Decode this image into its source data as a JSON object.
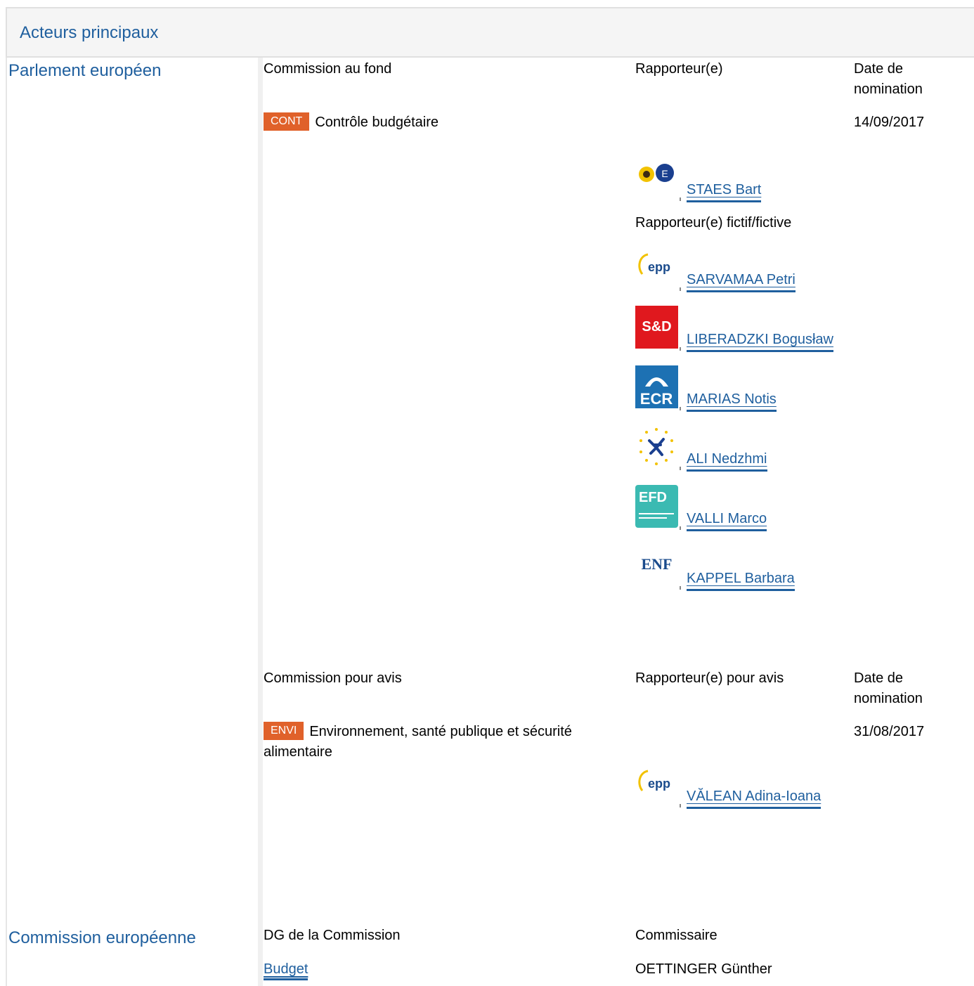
{
  "header": {
    "title": "Acteurs principaux"
  },
  "parliament": {
    "title": "Parlement européen",
    "lead": {
      "col_committee": "Commission au fond",
      "col_rapporteur": "Rapporteur(e)",
      "col_date": "Date de nomination",
      "committee_code": "CONT",
      "committee_name": "Contrôle budgétaire",
      "date": "14/09/2017",
      "rapporteur": {
        "name": "STAES Bart",
        "group_icon": "greens-efa-logo"
      },
      "shadow_label": "Rapporteur(e) fictif/fictive",
      "shadows": [
        {
          "name": "SARVAMAA Petri",
          "group_icon": "epp-logo"
        },
        {
          "name": "LIBERADZKI Bogusław",
          "group_icon": "s-and-d-logo",
          "group_text": "S&D"
        },
        {
          "name": "MARIAS Notis",
          "group_icon": "ecr-logo",
          "group_text": "ECR"
        },
        {
          "name": "ALI Nedzhmi",
          "group_icon": "alde-logo"
        },
        {
          "name": "VALLI Marco",
          "group_icon": "efdd-logo",
          "group_text": "EFD"
        },
        {
          "name": "KAPPEL Barbara",
          "group_icon": "enf-logo",
          "group_text": "ENF"
        }
      ]
    },
    "opinion": {
      "col_committee": "Commission pour avis",
      "col_rapporteur": "Rapporteur(e) pour avis",
      "col_date": "Date de nomination",
      "committee_code": "ENVI",
      "committee_name": "Environnement, santé publique et sécurité alimentaire",
      "date": "31/08/2017",
      "rapporteur": {
        "name": "VĂLEAN Adina-Ioana",
        "group_icon": "epp-logo"
      }
    }
  },
  "commission": {
    "title": "Commission européenne",
    "col_dg": "DG de la Commission",
    "col_commissioner": "Commissaire",
    "dg": "Budget",
    "commissioner": "OETTINGER Günther"
  },
  "colors": {
    "link": "#1f5f9e",
    "badge": "#e0612a"
  }
}
